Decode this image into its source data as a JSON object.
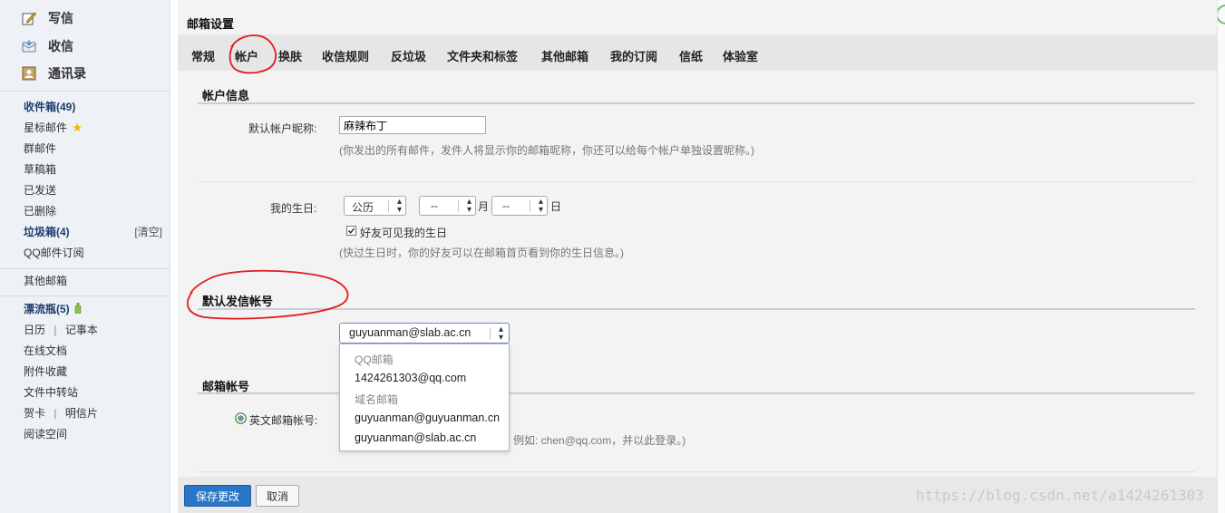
{
  "sidebar": {
    "compose": "写信",
    "receive": "收信",
    "contacts": "通讯录",
    "folders": [
      {
        "label": "收件箱(49)",
        "bold": true
      },
      {
        "label": "星标邮件",
        "bold": false
      },
      {
        "label": "群邮件",
        "bold": false
      },
      {
        "label": "草稿箱",
        "bold": false
      },
      {
        "label": "已发送",
        "bold": false
      },
      {
        "label": "已删除",
        "bold": false
      },
      {
        "label": "垃圾箱(4)",
        "bold": true
      },
      {
        "label": "QQ邮件订阅",
        "bold": false
      }
    ],
    "clear_label": "[清空]",
    "other_mailbox": "其他邮箱",
    "drift_bottle": "漂流瓶(5)",
    "calendar": "日历",
    "divider": "|",
    "notebook": "记事本",
    "online_docs": "在线文档",
    "attachments": "附件收藏",
    "file_transfer": "文件中转站",
    "greeting_card": "贺卡",
    "postcard": "明信片",
    "reading_space": "阅读空间"
  },
  "settings": {
    "title": "邮箱设置",
    "tabs": [
      "常规",
      "帐户",
      "换肤",
      "收信规则",
      "反垃圾",
      "文件夹和标签",
      "其他邮箱",
      "我的订阅",
      "信纸",
      "体验室"
    ],
    "active_tab": "帐户"
  },
  "account_info": {
    "section_title": "帐户信息",
    "nickname_label": "默认帐户昵称:",
    "nickname_value": "麻辣布丁",
    "nickname_hint": "(你发出的所有邮件，发件人将显示你的邮箱昵称，你还可以给每个帐户单独设置昵称。)",
    "birthday_label": "我的生日:",
    "calendar_type": "公历",
    "month_value": "--",
    "month_unit": "月",
    "day_value": "--",
    "day_unit": "日",
    "friends_visible_label": "好友可见我的生日",
    "friends_visible_checked": true,
    "birthday_hint": "(快过生日时，你的好友可以在邮箱首页看到你的生日信息。)"
  },
  "default_sender": {
    "section_title": "默认发信帐号",
    "selected": "guyuanman@slab.ac.cn",
    "dropdown": [
      {
        "type": "group",
        "label": "QQ邮箱"
      },
      {
        "type": "option",
        "label": "1424261303@qq.com"
      },
      {
        "type": "group",
        "label": "域名邮箱"
      },
      {
        "type": "option",
        "label": "guyuanman@guyuanman.cn"
      },
      {
        "type": "option",
        "label": "guyuanman@slab.ac.cn"
      }
    ]
  },
  "mailbox_account": {
    "section_title": "邮箱帐号",
    "english_label": "英文邮箱帐号:",
    "hint_visible": "例如: chen@qq.com，并以此登录。)"
  },
  "footer": {
    "save_label": "保存更改",
    "cancel_label": "取消"
  },
  "watermark": "https://blog.csdn.net/a1424261303",
  "colors": {
    "primary_button": "#2a76c6",
    "annotation": "#e31b1b",
    "folder_bold": "#1b3d6d"
  }
}
